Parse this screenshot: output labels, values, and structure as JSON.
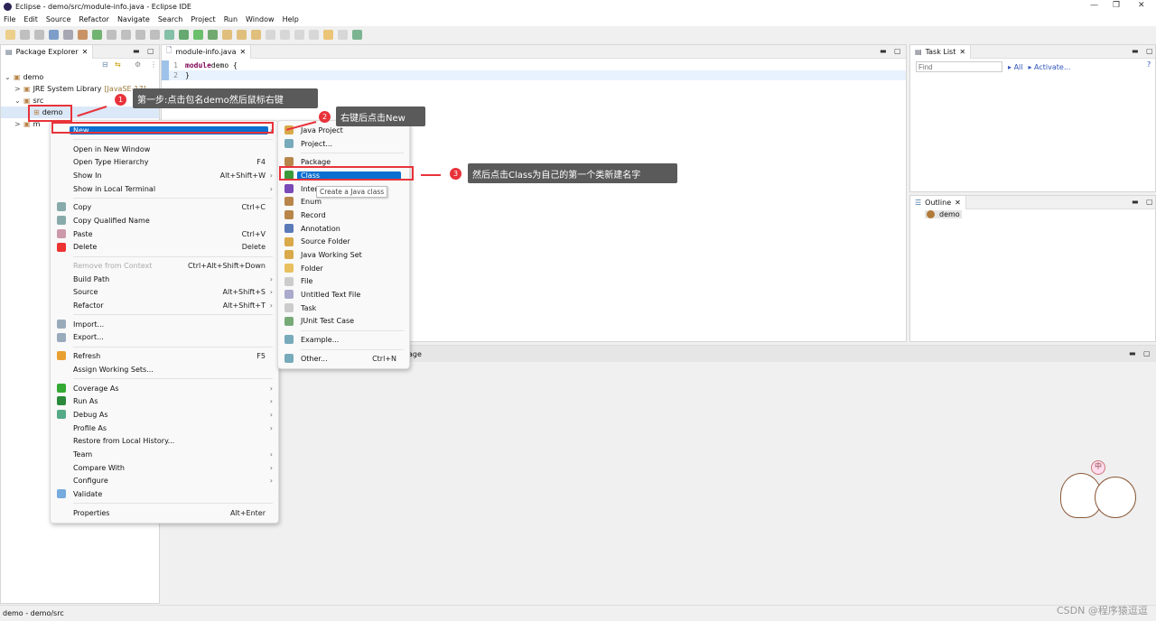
{
  "window": {
    "title": "Eclipse - demo/src/module-info.java - Eclipse IDE",
    "controls": [
      "—",
      "❐",
      "✕"
    ]
  },
  "menubar": [
    "File",
    "Edit",
    "Source",
    "Refactor",
    "Navigate",
    "Search",
    "Project",
    "Run",
    "Window",
    "Help"
  ],
  "package_explorer": {
    "title": "Package Explorer",
    "tree": [
      {
        "label": "demo",
        "indent": 0,
        "caret": "v"
      },
      {
        "label": "JRE System Library",
        "extra": "[JavaSE-17]",
        "indent": 1,
        "caret": ">"
      },
      {
        "label": "src",
        "indent": 1,
        "caret": "v"
      },
      {
        "label": "demo",
        "indent": 2,
        "caret": ""
      },
      {
        "label": "m",
        "indent": 1,
        "caret": ">"
      }
    ]
  },
  "editor": {
    "tab": "module-info.java",
    "lines": [
      {
        "n": "1",
        "kw": "module",
        "rest": " demo {"
      },
      {
        "n": "2",
        "kw": "",
        "rest": "}"
      }
    ]
  },
  "task_list": {
    "title": "Task List",
    "find_placeholder": "Find",
    "all": "All",
    "activate": "Activate..."
  },
  "outline": {
    "title": "Outline",
    "item": "demo"
  },
  "bottom_panel": {
    "partial_tab": "age",
    "partial_text": "e."
  },
  "context_menu": [
    {
      "label": "New",
      "arrow": true,
      "highlight": true
    },
    "sep",
    {
      "label": "Open in New Window"
    },
    {
      "label": "Open Type Hierarchy",
      "shortcut": "F4"
    },
    {
      "label": "Show In",
      "shortcut": "Alt+Shift+W",
      "arrow": true
    },
    {
      "label": "Show in Local Terminal",
      "arrow": true
    },
    "sep",
    {
      "label": "Copy",
      "shortcut": "Ctrl+C",
      "icon": "#8aa"
    },
    {
      "label": "Copy Qualified Name",
      "icon": "#8aa"
    },
    {
      "label": "Paste",
      "shortcut": "Ctrl+V",
      "icon": "#c9a"
    },
    {
      "label": "Delete",
      "shortcut": "Delete",
      "icon": "#e33"
    },
    "sep",
    {
      "label": "Remove from Context",
      "shortcut": "Ctrl+Alt+Shift+Down",
      "disabled": true
    },
    {
      "label": "Build Path",
      "arrow": true
    },
    {
      "label": "Source",
      "shortcut": "Alt+Shift+S",
      "arrow": true
    },
    {
      "label": "Refactor",
      "shortcut": "Alt+Shift+T",
      "arrow": true
    },
    "sep",
    {
      "label": "Import...",
      "icon": "#9ab"
    },
    {
      "label": "Export...",
      "icon": "#9ab"
    },
    "sep",
    {
      "label": "Refresh",
      "shortcut": "F5",
      "icon": "#e9a030"
    },
    {
      "label": "Assign Working Sets..."
    },
    "sep",
    {
      "label": "Coverage As",
      "arrow": true,
      "icon": "#3a3"
    },
    {
      "label": "Run As",
      "arrow": true,
      "icon": "#2a8a3a"
    },
    {
      "label": "Debug As",
      "arrow": true,
      "icon": "#5a8"
    },
    {
      "label": "Profile As",
      "arrow": true
    },
    {
      "label": "Restore from Local History..."
    },
    {
      "label": "Team",
      "arrow": true
    },
    {
      "label": "Compare With",
      "arrow": true
    },
    {
      "label": "Configure",
      "arrow": true
    },
    {
      "label": "Validate",
      "icon": "#7ad"
    },
    "sep",
    {
      "label": "Properties",
      "shortcut": "Alt+Enter"
    }
  ],
  "new_submenu": [
    {
      "label": "Java Project",
      "icon": "#d9a94a"
    },
    {
      "label": "Project...",
      "icon": "#7ab"
    },
    "sep",
    {
      "label": "Package",
      "icon": "#b8864a"
    },
    {
      "label": "Class",
      "icon": "#3a9a3a",
      "highlight": true
    },
    {
      "label": "Interface",
      "icon": "#7a4ab8"
    },
    {
      "label": "Enum",
      "icon": "#b8864a"
    },
    {
      "label": "Record",
      "icon": "#b8864a"
    },
    {
      "label": "Annotation",
      "icon": "#5a7ab8"
    },
    {
      "label": "Source Folder",
      "icon": "#d9a94a"
    },
    {
      "label": "Java Working Set",
      "icon": "#d9a94a"
    },
    {
      "label": "Folder",
      "icon": "#e8c060"
    },
    {
      "label": "File",
      "icon": "#ccc"
    },
    {
      "label": "Untitled Text File",
      "icon": "#aac"
    },
    {
      "label": "Task",
      "icon": "#ccc"
    },
    {
      "label": "JUnit Test Case",
      "icon": "#7a7"
    },
    "sep",
    {
      "label": "Example...",
      "icon": "#7ab"
    },
    "sep",
    {
      "label": "Other...",
      "shortcut": "Ctrl+N",
      "icon": "#7ab"
    }
  ],
  "tooltip": "Create a Java class",
  "annotations": [
    {
      "num": "1",
      "text": "第一步:点击包名demo然后鼠标右键"
    },
    {
      "num": "2",
      "text": "右键后点击New"
    },
    {
      "num": "3",
      "text": "然后点击Class为自己的第一个类新建名字"
    }
  ],
  "status_bar": {
    "text": "demo - demo/src"
  },
  "watermark": "CSDN @程序猿逗逗"
}
